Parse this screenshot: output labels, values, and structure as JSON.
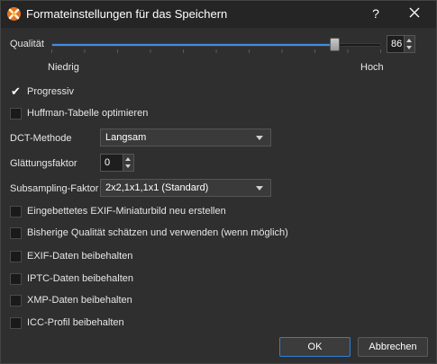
{
  "window": {
    "title": "Formateinstellungen für das Speichern",
    "help_label": "?"
  },
  "quality": {
    "label": "Qualität",
    "value": "86",
    "slider_fraction": 0.86,
    "min_label": "Niedrig",
    "max_label": "Hoch"
  },
  "progressive": {
    "label": "Progressiv",
    "checked": true
  },
  "huffman": {
    "label": "Huffman-Tabelle optimieren",
    "checked": false
  },
  "dct": {
    "label": "DCT-Methode",
    "selected": "Langsam"
  },
  "smoothing": {
    "label": "Glättungsfaktor",
    "value": "0"
  },
  "subsampling": {
    "label": "Subsampling-Faktor",
    "selected": "2x2,1x1,1x1 (Standard)"
  },
  "options": [
    {
      "label": "Eingebettetes EXIF-Miniaturbild neu erstellen",
      "checked": false
    },
    {
      "label": "Bisherige Qualität schätzen und verwenden (wenn möglich)",
      "checked": false
    },
    {
      "label": "EXIF-Daten beibehalten",
      "checked": false
    },
    {
      "label": "IPTC-Daten beibehalten",
      "checked": false
    },
    {
      "label": "XMP-Daten beibehalten",
      "checked": false
    },
    {
      "label": "ICC-Profil beibehalten",
      "checked": false
    }
  ],
  "buttons": {
    "ok": "OK",
    "cancel": "Abbrechen"
  },
  "colors": {
    "accent": "#3d8ee6",
    "background": "#2f2f2f",
    "titlebar": "#252525"
  }
}
